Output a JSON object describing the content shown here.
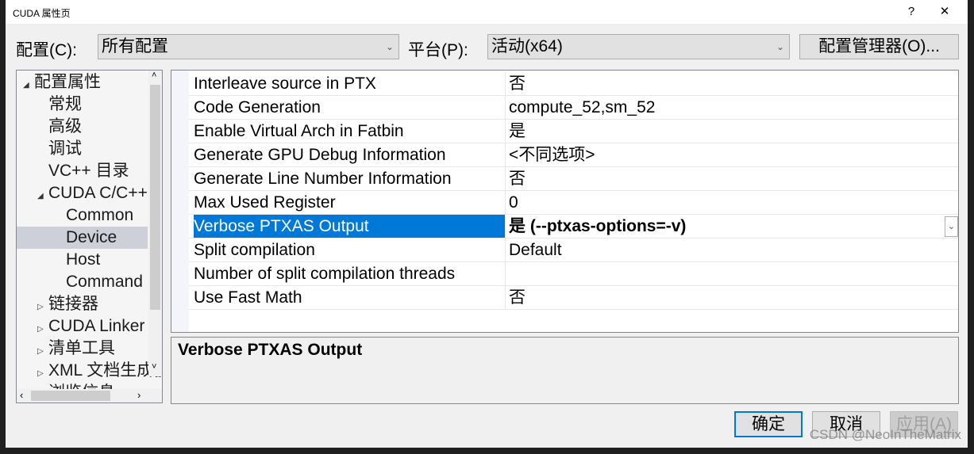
{
  "window": {
    "title": "CUDA 属性页",
    "help": "?",
    "close": "✕"
  },
  "toolbar": {
    "config_label": "配置(C):",
    "config_value": "所有配置",
    "platform_label": "平台(P):",
    "platform_value": "活动(x64)",
    "manager_button": "配置管理器(O)..."
  },
  "tree": [
    {
      "label": "配置属性",
      "twisty": "◢",
      "level": 0
    },
    {
      "label": "常规",
      "level": 1
    },
    {
      "label": "高级",
      "level": 1
    },
    {
      "label": "调试",
      "level": 1
    },
    {
      "label": "VC++ 目录",
      "level": 1
    },
    {
      "label": "CUDA C/C++",
      "twisty": "◢",
      "level": 1
    },
    {
      "label": "Common",
      "level": 2
    },
    {
      "label": "Device",
      "level": 2,
      "selected": true
    },
    {
      "label": "Host",
      "level": 2
    },
    {
      "label": "Command Line",
      "level": 2
    },
    {
      "label": "链接器",
      "twisty": "▷",
      "level": 1
    },
    {
      "label": "CUDA Linker",
      "twisty": "▷",
      "level": 1
    },
    {
      "label": "清单工具",
      "twisty": "▷",
      "level": 1
    },
    {
      "label": "XML 文档生成器",
      "twisty": "▷",
      "level": 1
    },
    {
      "label": "浏览信息",
      "twisty": "▷",
      "level": 1
    }
  ],
  "properties": [
    {
      "name": "Interleave source in PTX",
      "value": "否"
    },
    {
      "name": "Code Generation",
      "value": "compute_52,sm_52"
    },
    {
      "name": "Enable Virtual Arch in Fatbin",
      "value": "是"
    },
    {
      "name": "Generate GPU Debug Information",
      "value": "<不同选项>"
    },
    {
      "name": "Generate Line Number Information",
      "value": "否"
    },
    {
      "name": "Max Used Register",
      "value": "0"
    },
    {
      "name": "Verbose PTXAS Output",
      "value": "是 (--ptxas-options=-v)",
      "selected": true
    },
    {
      "name": "Split compilation",
      "value": "Default"
    },
    {
      "name": "Number of split compilation threads",
      "value": ""
    },
    {
      "name": "Use Fast Math",
      "value": "否"
    }
  ],
  "description": {
    "title": "Verbose PTXAS Output"
  },
  "buttons": {
    "ok": "确定",
    "cancel": "取消",
    "apply": "应用(A)"
  },
  "watermark": "CSDN @NeoInTheMatrix",
  "colors": {
    "selection": "#0078d7",
    "tree_selection": "#cdd0d8"
  }
}
